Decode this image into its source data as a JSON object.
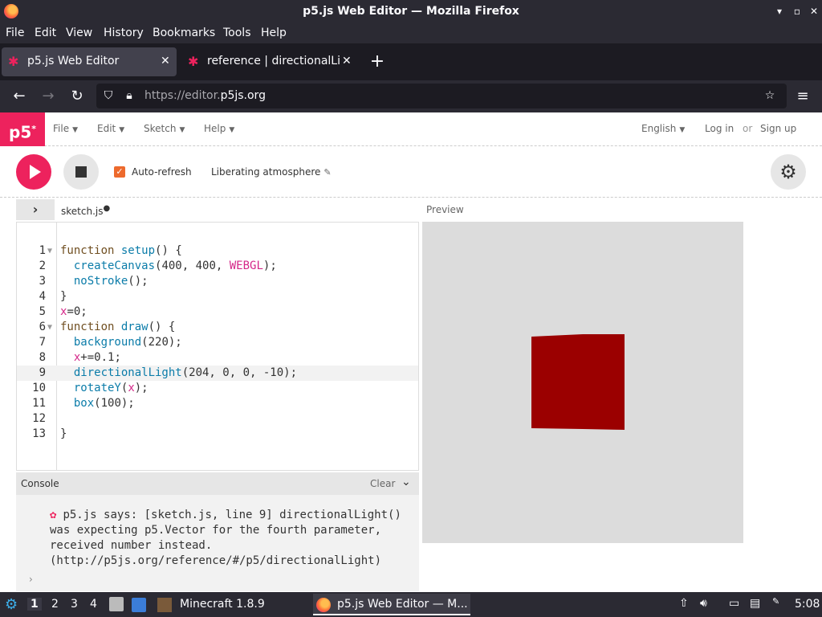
{
  "window": {
    "title": "p5.js Web Editor — Mozilla Firefox"
  },
  "menubar": [
    "File",
    "Edit",
    "View",
    "History",
    "Bookmarks",
    "Tools",
    "Help"
  ],
  "tabs": [
    {
      "label": "p5.js Web Editor",
      "active": true
    },
    {
      "label": "reference | directionalLig",
      "active": false
    }
  ],
  "urlbar": {
    "url_prefix": "https://editor.",
    "url_domain": "p5js.org"
  },
  "p5nav": {
    "logo": "p5",
    "menus": [
      "File",
      "Edit",
      "Sketch",
      "Help"
    ],
    "language": "English",
    "login": "Log in",
    "or": "or",
    "signup": "Sign up"
  },
  "toolbar": {
    "autorefresh_label": "Auto-refresh",
    "autorefresh_checked": true,
    "sketch_name": "Liberating atmosphere"
  },
  "editor": {
    "filename": "sketch.js",
    "unsaved_dot": "●",
    "preview_label": "Preview",
    "active_line": 9,
    "lines": [
      "function setup() {",
      "  createCanvas(400, 400, WEBGL);",
      "  noStroke();",
      "}",
      "x=0;",
      "function draw() {",
      "  background(220);",
      "  x+=0.1;",
      "  directionalLight(204, 0, 0, -10);",
      "  rotateY(x);",
      "  box(100);",
      "",
      "}"
    ]
  },
  "console": {
    "title": "Console",
    "clear_label": "Clear",
    "message": "p5.js says: [sketch.js, line 9] directionalLight() was expecting p5.Vector for the fourth parameter, received number instead. (http://p5js.org/reference/#/p5/directionalLight)",
    "prompt": "›"
  },
  "preview": {
    "background": "#dcdcdc",
    "box_color": "#9b0000"
  },
  "taskbar": {
    "workspaces": [
      "1",
      "2",
      "3",
      "4"
    ],
    "windows": [
      {
        "label": "Minecraft 1.8.9",
        "active": false
      },
      {
        "label": "p5.js Web Editor — M...",
        "active": true
      }
    ],
    "clock": "5:08"
  }
}
